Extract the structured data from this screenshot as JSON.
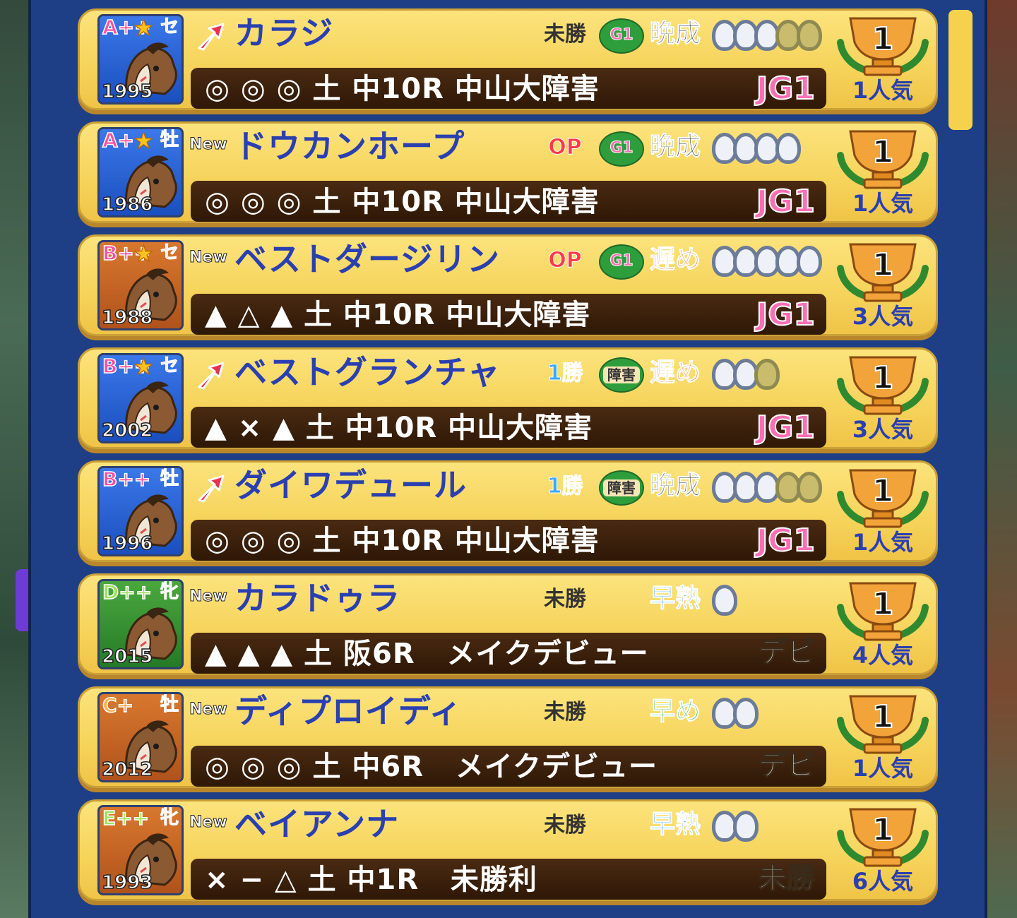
{
  "horses": [
    {
      "rank": "A++",
      "rank_color": "#ff4fa0",
      "star": true,
      "sex": "セ",
      "year": "1995",
      "avatar_bg": "blue",
      "tag": "arrow",
      "name": "カラジ",
      "class": "未勝",
      "class_style": "dark",
      "grade_icon": "G1",
      "growth": "晩成",
      "growth_style": "dark",
      "shoes_on": 3,
      "shoes_total": 5,
      "marks": "◎ ◎ ◎ 土 中10R 中山大障害",
      "race_grade": "JG1",
      "trophy": "1",
      "popularity": "1人気"
    },
    {
      "rank": "A+",
      "rank_color": "#ff4fa0",
      "star": true,
      "sex": "牡",
      "year": "1986",
      "avatar_bg": "blue",
      "tag": "new",
      "name": "ドウカンホープ",
      "class": "OP",
      "class_style": "red",
      "grade_icon": "G1",
      "growth": "晩成",
      "growth_style": "dark",
      "shoes_on": 4,
      "shoes_total": 4,
      "marks": "◎ ◎ ◎ 土 中10R 中山大障害",
      "race_grade": "JG1",
      "trophy": "1",
      "popularity": "1人気"
    },
    {
      "rank": "B++",
      "rank_color": "#ff4fa0",
      "star": true,
      "sex": "セ",
      "year": "1988",
      "avatar_bg": "brown",
      "tag": "new",
      "name": "ベストダージリン",
      "class": "OP",
      "class_style": "red",
      "grade_icon": "G1",
      "growth": "遅め",
      "growth_style": "orange",
      "shoes_on": 5,
      "shoes_total": 5,
      "marks": "▲ △ ▲ 土 中10R 中山大障害",
      "race_grade": "JG1",
      "trophy": "1",
      "popularity": "3人気"
    },
    {
      "rank": "B++",
      "rank_color": "#ff4fa0",
      "star": true,
      "sex": "セ",
      "year": "2002",
      "avatar_bg": "blue",
      "tag": "arrow",
      "name": "ベストグランチャ",
      "class": "1勝",
      "class_style": "blue",
      "grade_icon": "障害",
      "growth": "遅め",
      "growth_style": "orange",
      "shoes_on": 2,
      "shoes_total": 3,
      "marks": "▲ × ▲ 土 中10R 中山大障害",
      "race_grade": "JG1",
      "trophy": "1",
      "popularity": "3人気"
    },
    {
      "rank": "B++",
      "rank_color": "#ff4fa0",
      "star": false,
      "sex": "牡",
      "year": "1996",
      "avatar_bg": "blue",
      "tag": "arrow",
      "name": "ダイワデュール",
      "class": "1勝",
      "class_style": "blue",
      "grade_icon": "障害",
      "growth": "晩成",
      "growth_style": "dark",
      "shoes_on": 3,
      "shoes_total": 5,
      "marks": "◎ ◎ ◎ 土 中10R 中山大障害",
      "race_grade": "JG1",
      "trophy": "1",
      "popularity": "1人気"
    },
    {
      "rank": "D++",
      "rank_color": "#9be35a",
      "star": false,
      "sex": "牝",
      "year": "2015",
      "avatar_bg": "green",
      "tag": "new",
      "name": "カラドゥラ",
      "class": "未勝",
      "class_style": "dark",
      "grade_icon": "",
      "growth": "早熟",
      "growth_style": "cyan",
      "shoes_on": 1,
      "shoes_total": 1,
      "marks": "▲ ▲ ▲ 土 阪6R   メイクデビュー",
      "race_grade": "デビ",
      "trophy": "1",
      "popularity": "4人気"
    },
    {
      "rank": "C+",
      "rank_color": "#ffb04a",
      "star": false,
      "sex": "牡",
      "year": "2012",
      "avatar_bg": "brown",
      "tag": "new",
      "name": "ディプロイディ",
      "class": "未勝",
      "class_style": "dark",
      "grade_icon": "",
      "growth": "早め",
      "growth_style": "green",
      "shoes_on": 2,
      "shoes_total": 2,
      "marks": "◎ ◎ ◎ 土 中6R   メイクデビュー",
      "race_grade": "デビ",
      "trophy": "1",
      "popularity": "1人気"
    },
    {
      "rank": "E++",
      "rank_color": "#9be35a",
      "star": false,
      "sex": "牝",
      "year": "1993",
      "avatar_bg": "brown",
      "tag": "new",
      "name": "ベイアンナ",
      "class": "未勝",
      "class_style": "dark",
      "grade_icon": "",
      "growth": "早熟",
      "growth_style": "cyan",
      "shoes_on": 2,
      "shoes_total": 2,
      "marks": "× − △ 土 中1R   未勝利",
      "race_grade": "未勝",
      "trophy": "1",
      "popularity": "6人気"
    }
  ],
  "new_label": "New",
  "scroll_position": 0.0
}
